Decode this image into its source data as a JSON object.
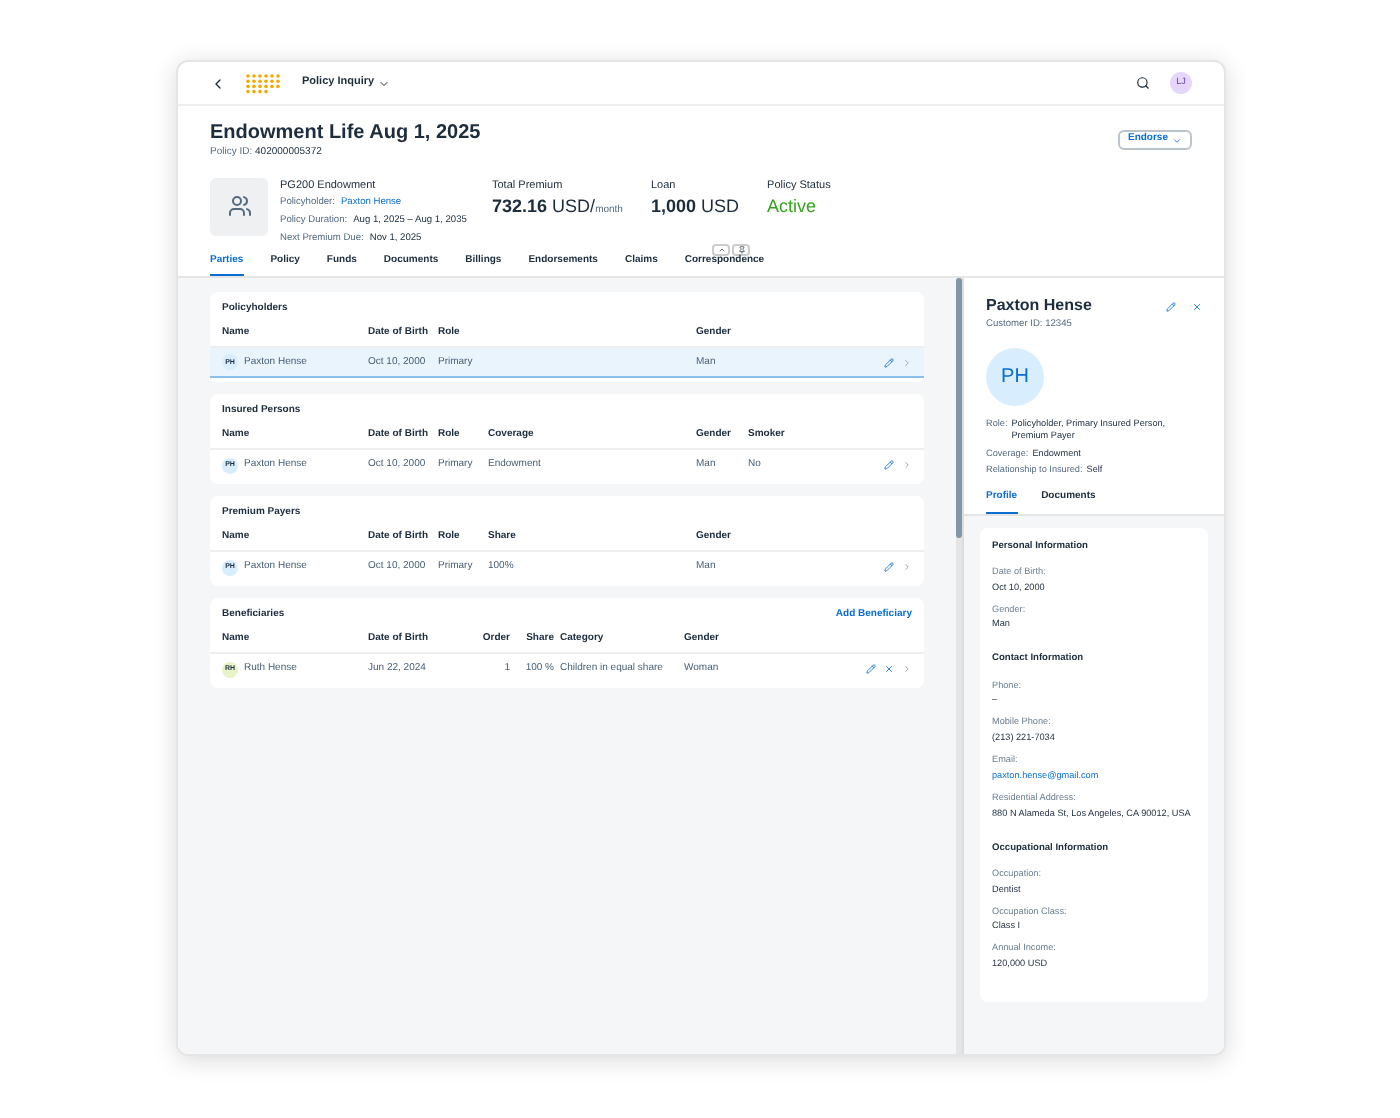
{
  "shell": {
    "app_title": "Policy Inquiry",
    "avatar": "LJ"
  },
  "header": {
    "title": "Endowment Life Aug 1, 2025",
    "policy_id_label": "Policy ID:",
    "policy_id": "402000005372",
    "action": "Endorse",
    "product": "PG200 Endowment",
    "facts": [
      {
        "label": "Policyholder:",
        "value": "Paxton Hense",
        "link": true
      },
      {
        "label": "Policy Duration:",
        "value": "Aug 1, 2025 – Aug 1, 2035",
        "link": false
      },
      {
        "label": "Next Premium Due:",
        "value": "Nov 1, 2025",
        "link": false
      }
    ],
    "kpis": [
      {
        "label": "Total Premium",
        "value": "732.16",
        "unit": "USD/",
        "suffix": "month",
        "kind": "amount"
      },
      {
        "label": "Loan",
        "value": "1,000",
        "unit": "USD",
        "kind": "amount"
      },
      {
        "label": "Policy Status",
        "value": "Active",
        "kind": "status"
      }
    ]
  },
  "tabs": [
    {
      "label": "Parties",
      "selected": true
    },
    {
      "label": "Policy",
      "selected": false
    },
    {
      "label": "Funds",
      "selected": false
    },
    {
      "label": "Documents",
      "selected": false
    },
    {
      "label": "Billings",
      "selected": false
    },
    {
      "label": "Endorsements",
      "selected": false
    },
    {
      "label": "Claims",
      "selected": false
    },
    {
      "label": "Correspondence",
      "selected": false
    }
  ],
  "sections": [
    {
      "title": "Policyholders",
      "columns": [
        "Name",
        "Date of Birth",
        "Role",
        "",
        "Gender"
      ],
      "rows": [
        {
          "initials": "PH",
          "color": "#d8eefe",
          "selected": true,
          "removable": false,
          "cells": [
            "Paxton Hense",
            "Oct 10, 2000",
            "Primary",
            "",
            "Man"
          ]
        }
      ]
    },
    {
      "title": "Insured Persons",
      "columns": [
        "Name",
        "Date of Birth",
        "Role",
        "Coverage",
        "Gender",
        "Smoker"
      ],
      "rows": [
        {
          "initials": "PH",
          "color": "#d8eefe",
          "selected": false,
          "removable": false,
          "cells": [
            "Paxton Hense",
            "Oct 10, 2000",
            "Primary",
            "Endowment",
            "Man",
            "No"
          ]
        }
      ]
    },
    {
      "title": "Premium Payers",
      "columns": [
        "Name",
        "Date of Birth",
        "Role",
        "Share",
        "Gender"
      ],
      "rows": [
        {
          "initials": "PH",
          "color": "#d8eefe",
          "selected": false,
          "removable": false,
          "cells": [
            "Paxton Hense",
            "Oct 10, 2000",
            "Primary",
            "100%",
            "Man"
          ]
        }
      ]
    },
    {
      "title": "Beneficiaries",
      "action": "Add Beneficiary",
      "columns": [
        "Name",
        "Date of Birth",
        "Order",
        "Share",
        "Category",
        "Gender"
      ],
      "rows": [
        {
          "initials": "RH",
          "color": "#e8f3c7",
          "selected": false,
          "removable": true,
          "cells": [
            "Ruth Hense",
            "Jun 22, 2024",
            "1",
            "100 %",
            "Children in equal share",
            "Woman"
          ]
        }
      ]
    }
  ],
  "detail": {
    "name": "Paxton Hense",
    "customer_id": "Customer ID: 12345",
    "initials": "PH",
    "attributes": [
      {
        "label": "Role:",
        "value": "Policyholder, Primary Insured Person, Premium Payer"
      },
      {
        "label": "Coverage:",
        "value": "Endowment"
      },
      {
        "label": "Relationship to Insured:",
        "value": "Self"
      }
    ],
    "tabs": [
      {
        "label": "Profile",
        "selected": true
      },
      {
        "label": "Documents",
        "selected": false
      }
    ],
    "groups": [
      {
        "title": "Personal Information",
        "fields": [
          {
            "label": "Date of Birth:",
            "value": "Oct 10, 2000",
            "link": false
          },
          {
            "label": "Gender:",
            "value": "Man",
            "link": false
          }
        ]
      },
      {
        "title": "Contact Information",
        "fields": [
          {
            "label": "Phone:",
            "value": "–",
            "link": false
          },
          {
            "label": "Mobile Phone:",
            "value": "(213) 221-7034",
            "link": false
          },
          {
            "label": "Email:",
            "value": "paxton.hense@gmail.com",
            "link": true
          },
          {
            "label": "Residential Address:",
            "value": "880 N Alameda St, Los Angeles, CA 90012, USA",
            "link": false
          }
        ]
      },
      {
        "title": "Occupational Information",
        "fields": [
          {
            "label": "Occupation:",
            "value": "Dentist",
            "link": false
          },
          {
            "label": "Occupation Class:",
            "value": "Class I",
            "link": false
          },
          {
            "label": "Annual Income:",
            "value": "120,000 USD",
            "link": false
          }
        ]
      }
    ]
  }
}
